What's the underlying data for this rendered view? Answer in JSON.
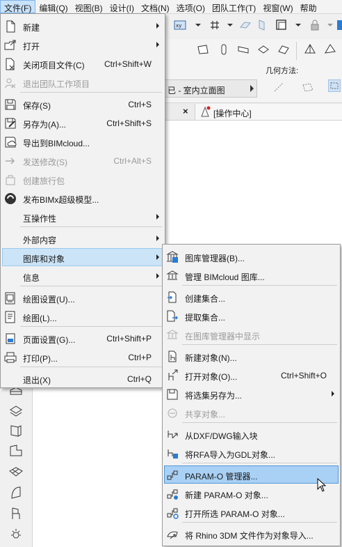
{
  "menubar": {
    "items": [
      {
        "label": "文件(F)",
        "active": true
      },
      {
        "label": "编辑(Q)"
      },
      {
        "label": "视图(B)"
      },
      {
        "label": "设计(I)"
      },
      {
        "label": "文档(N)"
      },
      {
        "label": "选项(O)"
      },
      {
        "label": "团队工作(T)"
      },
      {
        "label": "视窗(W)"
      },
      {
        "label": "帮助"
      }
    ]
  },
  "toolbar": {
    "view_combo": "已 - 室内立面图",
    "geometry_label": "几何方法:"
  },
  "tabs": {
    "close_symbol": "×",
    "action_center": "[操作中心]"
  },
  "file_menu": {
    "items": [
      {
        "label": "新建",
        "shortcut": "",
        "submenu": true,
        "icon": "new-document-icon"
      },
      {
        "label": "打开",
        "shortcut": "",
        "submenu": true,
        "icon": "open-folder-icon"
      },
      {
        "label": "关闭项目文件(C)",
        "shortcut": "Ctrl+Shift+W",
        "icon": "close-project-icon"
      },
      {
        "label": "退出团队工作项目",
        "shortcut": "",
        "disabled": true,
        "icon": "leave-team-icon"
      },
      {
        "label": "保存(S)",
        "shortcut": "Ctrl+S",
        "icon": "save-icon"
      },
      {
        "label": "另存为(A)...",
        "shortcut": "Ctrl+Shift+S",
        "icon": "save-as-icon"
      },
      {
        "label": "导出到BIMcloud...",
        "shortcut": "",
        "icon": "export-bimcloud-icon"
      },
      {
        "label": "发送修改(S)",
        "shortcut": "Ctrl+Alt+S",
        "disabled": true,
        "icon": "send-changes-icon"
      },
      {
        "label": "创建旅行包",
        "shortcut": "",
        "disabled": true,
        "icon": "travel-pack-icon"
      },
      {
        "label": "发布BIMx超级模型...",
        "shortcut": "",
        "icon": "bimx-icon"
      },
      {
        "label": "互操作性",
        "shortcut": "",
        "submenu": true,
        "icon": ""
      },
      {
        "label": "外部内容",
        "shortcut": "",
        "submenu": true,
        "icon": ""
      },
      {
        "label": "图库和对象",
        "shortcut": "",
        "submenu": true,
        "highlighted": true,
        "icon": ""
      },
      {
        "label": "信息",
        "shortcut": "",
        "submenu": true,
        "icon": ""
      },
      {
        "label": "绘图设置(U)...",
        "shortcut": "",
        "icon": "plot-setup-icon"
      },
      {
        "label": "绘图(L)...",
        "shortcut": "",
        "icon": "plot-icon"
      },
      {
        "label": "页面设置(G)...",
        "shortcut": "Ctrl+Shift+P",
        "icon": "page-setup-icon"
      },
      {
        "label": "打印(P)...",
        "shortcut": "Ctrl+P",
        "icon": "print-icon"
      },
      {
        "label": "退出(X)",
        "shortcut": "Ctrl+Q",
        "icon": ""
      }
    ]
  },
  "library_menu": {
    "items": [
      {
        "label": "图库管理器(B)...",
        "shortcut": "",
        "icon": "library-manager-icon"
      },
      {
        "label": "管理 BIMcloud 图库...",
        "shortcut": "",
        "icon": "bimcloud-library-icon"
      },
      {
        "label": "创建集合...",
        "shortcut": "",
        "icon": "create-collection-icon"
      },
      {
        "label": "提取集合...",
        "shortcut": "",
        "icon": "extract-collection-icon"
      },
      {
        "label": "在图库管理器中显示",
        "shortcut": "",
        "disabled": true,
        "icon": "show-in-library-icon"
      },
      {
        "label": "新建对象(N)...",
        "shortcut": "",
        "icon": "new-object-icon"
      },
      {
        "label": "打开对象(O)...",
        "shortcut": "Ctrl+Shift+O",
        "icon": "open-object-icon"
      },
      {
        "label": "将选集另存为...",
        "shortcut": "",
        "submenu": true,
        "icon": "save-selection-icon"
      },
      {
        "label": "共享对象...",
        "shortcut": "",
        "disabled": true,
        "icon": "share-object-icon"
      },
      {
        "label": "从DXF/DWG输入块",
        "shortcut": "",
        "icon": "dxf-import-icon"
      },
      {
        "label": "将RFA导入为GDL对象...",
        "shortcut": "",
        "icon": "rfa-import-icon"
      },
      {
        "label": "PARAM-O 管理器...",
        "shortcut": "",
        "highlighted": true,
        "icon": "param-o-manager-icon"
      },
      {
        "label": "新建 PARAM-O 对象...",
        "shortcut": "",
        "icon": "new-param-o-icon"
      },
      {
        "label": "打开所选 PARAM-O 对象...",
        "shortcut": "",
        "icon": "open-param-o-icon"
      },
      {
        "label": "将 Rhino 3DM 文件作为对象导入...",
        "shortcut": "",
        "icon": "rhino-import-icon"
      }
    ]
  }
}
